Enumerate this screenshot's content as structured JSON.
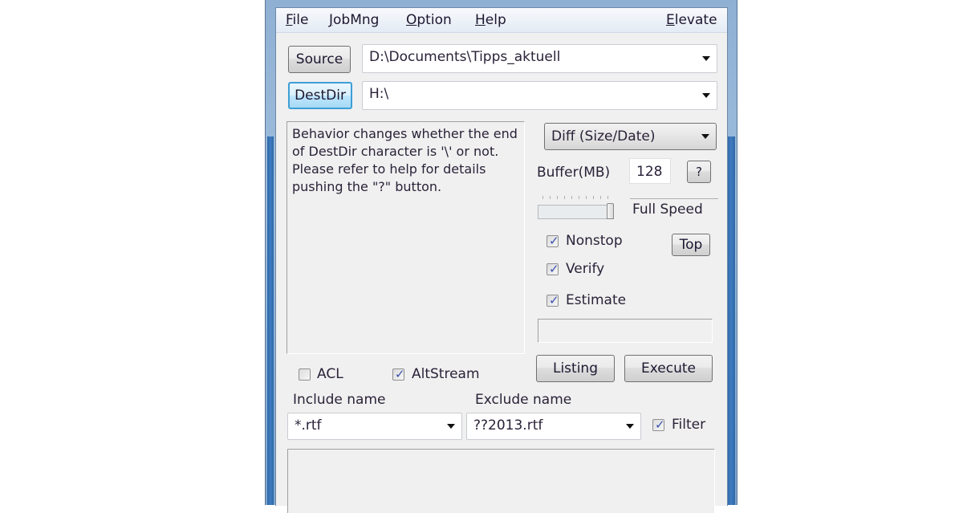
{
  "menu": {
    "file": {
      "acc": "F",
      "rest": "ile"
    },
    "jobmng": {
      "acc": "J",
      "rest": "obMng"
    },
    "option": {
      "acc": "O",
      "rest": "ption"
    },
    "help": {
      "acc": "H",
      "rest": "elp"
    },
    "elevate": {
      "acc": "E",
      "rest": "levate"
    }
  },
  "paths": {
    "source_label": "Source",
    "source_value": "D:\\Documents\\Tipps_aktuell",
    "dest_label": "DestDir",
    "dest_value": "H:\\"
  },
  "message": "Behavior changes whether the end of DestDir character is '\\' or not. Please refer to help for details pushing the \"?\" button.",
  "options": {
    "mode": "Diff (Size/Date)",
    "buffer_label": "Buffer(MB)",
    "buffer_value": "128",
    "help_button": "?",
    "speed_label": "Full Speed",
    "speed_level_percent": 100,
    "top_button": "Top",
    "checkboxes": [
      {
        "label": "Nonstop",
        "checked": true
      },
      {
        "label": "Verify",
        "checked": true
      },
      {
        "label": "Estimate",
        "checked": true
      }
    ],
    "status_text": ""
  },
  "actions": {
    "listing": "Listing",
    "execute": "Execute"
  },
  "bottom_checkboxes": [
    {
      "label": "ACL",
      "checked": false
    },
    {
      "label": "AltStream",
      "checked": true
    }
  ],
  "filters": {
    "include_label": "Include name",
    "include_value": "*.rtf",
    "exclude_label": "Exclude name",
    "exclude_value": "??2013.rtf",
    "filter_label": "Filter",
    "filter_checked": true
  },
  "log_text": ""
}
